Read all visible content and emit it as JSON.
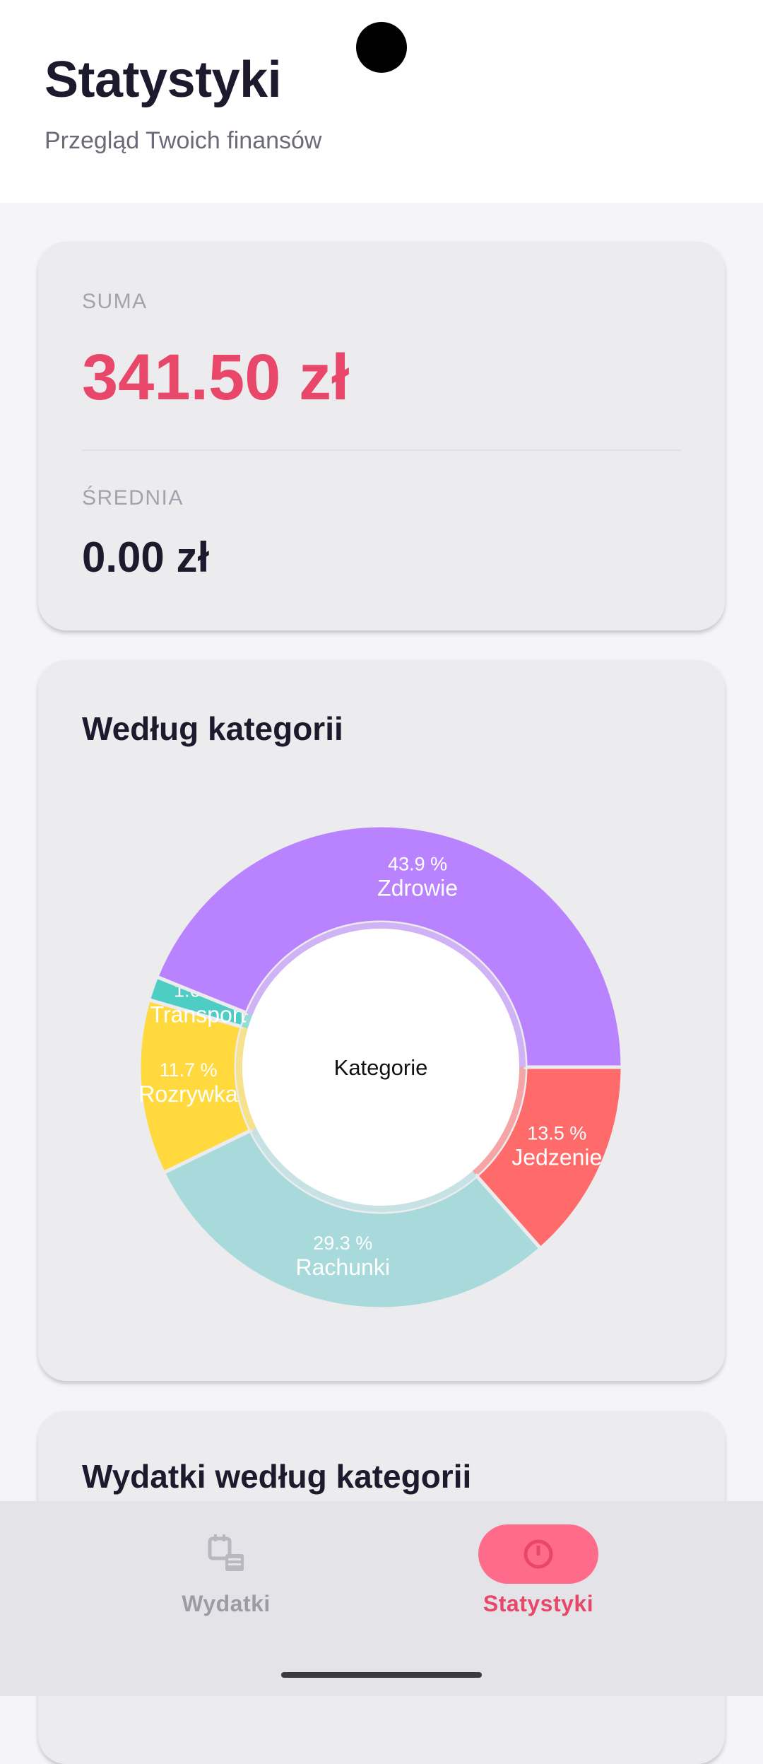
{
  "header": {
    "title": "Statystyki",
    "subtitle": "Przegląd Twoich finansów"
  },
  "summary": {
    "sum_label": "SUMA",
    "sum_value": "341.50 zł",
    "avg_label": "ŚREDNIA",
    "avg_value": "0.00 zł"
  },
  "category_card": {
    "title": "Według kategorii"
  },
  "chart_data": {
    "type": "pie",
    "center_label": "Kategorie",
    "slices": [
      {
        "name": "Jedzenie",
        "percent": 13.5,
        "label": "13.5 %",
        "color": "#ff6b6b"
      },
      {
        "name": "Rachunki",
        "percent": 29.3,
        "label": "29.3 %",
        "color": "#a8dadc"
      },
      {
        "name": "Rozrywka",
        "percent": 11.7,
        "label": "11.7 %",
        "color": "#ffd93d"
      },
      {
        "name": "Transport",
        "percent": 1.6,
        "label": "1.6 %",
        "color": "#4ecdc4"
      },
      {
        "name": "Zdrowie",
        "percent": 43.9,
        "label": "43.9 %",
        "color": "#b983ff"
      }
    ]
  },
  "expenses_card": {
    "title": "Wydatki według kategorii"
  },
  "nav": {
    "expenses_label": "Wydatki",
    "stats_label": "Statystyki",
    "expenses_icon": "calendar-list-icon",
    "stats_icon": "pie-chart-icon"
  },
  "colors": {
    "accent": "#e8476a",
    "pill": "#ff6b8a"
  }
}
